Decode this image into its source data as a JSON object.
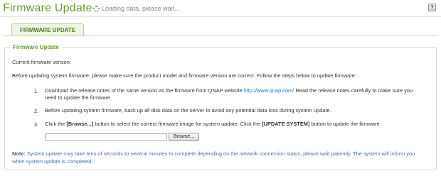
{
  "header": {
    "title": "Firmware Update",
    "loading_text": "Loading data, please wait..."
  },
  "tabs": [
    {
      "label": "FIRMWARE UPDATE",
      "active": true
    }
  ],
  "panel": {
    "legend": "Firmware Update",
    "current_version_label": "Current firmware version:",
    "intro": "Before updating system firmware, please make sure the product model and firmware version are correct. Follow the steps below to update firmware:",
    "steps": [
      {
        "num": "1.",
        "part1": "Download the release notes of the same version as the firmware from QNAP website ",
        "link": "http://www.qnap.com/",
        "part2": " Read the release notes carefully to make sure you",
        "line2": "need to update the firmware."
      },
      {
        "num": "2.",
        "text": "Before updating system firmware, back up all disk data on the server to avoid any potential data loss during system update."
      },
      {
        "num": "3.",
        "part1": "Click the ",
        "bold1": "[Browse...]",
        "part2": " button to select the correct firmware image for system update. Click the ",
        "bold2": "[UPDATE SYSTEM]",
        "part3": " button to update the firmware."
      }
    ],
    "browse_label": "Browse...",
    "note_label": "Note:",
    "note_line1": " System update may take tens of seconds to several minutes to complete depending on the network connection status, please wait patiently. The system will inform you",
    "note_line2": "when system update is completed."
  },
  "colors": {
    "accent_green": "#6a9c2e",
    "link_blue": "#1a73c9",
    "note_blue": "#4a6fa8"
  }
}
